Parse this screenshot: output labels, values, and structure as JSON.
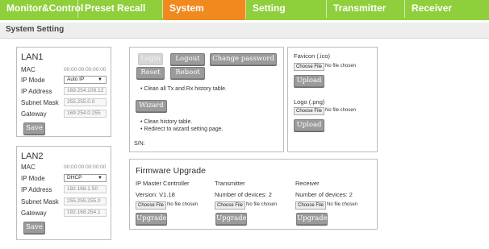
{
  "nav": {
    "tabs": [
      "Monitor&Control",
      "Preset Recall",
      "System",
      "Setting",
      "Transmitter",
      "Receiver"
    ],
    "active": "System"
  },
  "section_title": "System Setting",
  "lan1": {
    "title": "LAN1",
    "mac_label": "MAC",
    "mac_value": "00:00:00:00:00:00",
    "ipmode_label": "IP Mode",
    "ipmode_value": "Auto IP",
    "ip_label": "IP Address",
    "ip_value": "169.254.109.12",
    "mask_label": "Subnet Mask",
    "mask_value": "255.255.0.0",
    "gw_label": "Gateway",
    "gw_value": "169.254.0.255",
    "save": "Save"
  },
  "lan2": {
    "title": "LAN2",
    "mac_label": "MAC",
    "mac_value": "00:00:00:00:00:00",
    "ipmode_label": "IP Mode",
    "ipmode_value": "DHCP",
    "ip_label": "IP Address",
    "ip_value": "192.168.1.50",
    "mask_label": "Subnet Mask",
    "mask_value": "255.255.255.0",
    "gw_label": "Gateway",
    "gw_value": "192.168.254.1",
    "save": "Save"
  },
  "account": {
    "login": "Login",
    "logout": "Logout",
    "change_password": "Change password",
    "reset": "Reset",
    "reboot": "Reboot",
    "reset_note": "Clean all Tx and Rx history table.",
    "wizard": "Wizard",
    "wizard_note1": "Clean history table.",
    "wizard_note2": "Redirect to wizard setting page.",
    "sn_label": "S/N:"
  },
  "uploads": {
    "favicon_title": "Favicon (.ico)",
    "logo_title": "Logo (.png)",
    "choose_file": "Choose File",
    "no_file": "No file chosen",
    "upload": "Upload"
  },
  "firmware": {
    "title": "Firmware Upgrade",
    "col1_title": "IP Master Controller",
    "col1_info": "Version: V1.18",
    "col2_title": "Transmitter",
    "col2_info": "Number of devices: 2",
    "col3_title": "Receiver",
    "col3_info": "Number of devices: 2",
    "choose_file": "Choose File",
    "no_file": "No file chosen",
    "upgrade": "Upgrade"
  },
  "icons": {
    "bullet": "bullet-dot",
    "dropdown": "caret-down-icon"
  },
  "colors": {
    "nav_bg": "#8fcf3c",
    "active_tab": "#f0891e",
    "button": "#9b9b9b"
  }
}
